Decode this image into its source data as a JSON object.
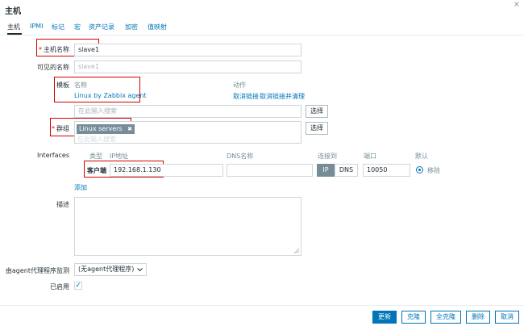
{
  "dialog": {
    "title": "主机",
    "close_icon": "×"
  },
  "tabs": [
    {
      "label": "主机"
    },
    {
      "label": "IPMI"
    },
    {
      "label": "标记"
    },
    {
      "label": "宏"
    },
    {
      "label": "资产记录"
    },
    {
      "label": "加密"
    },
    {
      "label": "值映射"
    }
  ],
  "form": {
    "host_name": {
      "label": "主机名称",
      "value": "slave1"
    },
    "visible_name": {
      "label": "可见的名称",
      "placeholder": "slave1"
    },
    "templates": {
      "label": "模板",
      "col_name": "名称",
      "col_action": "动作",
      "item": "Linux by Zabbix agent",
      "unlink": "取消链接",
      "unlink_clear": "取消链接并清理",
      "search_placeholder": "在此输入搜索",
      "select_button": "选择"
    },
    "groups": {
      "label": "群组",
      "chip": "Linux servers",
      "chip_remove": "✖",
      "search_placeholder": "在此输入搜索",
      "select_button": "选择"
    },
    "interfaces": {
      "label": "Interfaces",
      "col_type": "类型",
      "col_ip": "IP地址",
      "col_dns": "DNS名称",
      "col_connect": "连接到",
      "col_port": "端口",
      "col_default": "默认",
      "type": "客户端",
      "ip": "192.168.1.130",
      "dns": "",
      "connect_ip": "IP",
      "connect_dns": "DNS",
      "port": "10050",
      "remove": "移除",
      "add": "添加"
    },
    "description": {
      "label": "描述",
      "value": ""
    },
    "proxy": {
      "label": "由agent代理程序监测",
      "value": "(无agent代理程序)"
    },
    "enabled": {
      "label": "已启用",
      "check": "✓"
    }
  },
  "footer": {
    "update": "更新",
    "clone": "克隆",
    "full_clone": "全克隆",
    "delete": "删除",
    "cancel": "取消"
  },
  "colors": {
    "accent": "#0275b8",
    "required": "#d40000",
    "highlight": "#d50000"
  }
}
